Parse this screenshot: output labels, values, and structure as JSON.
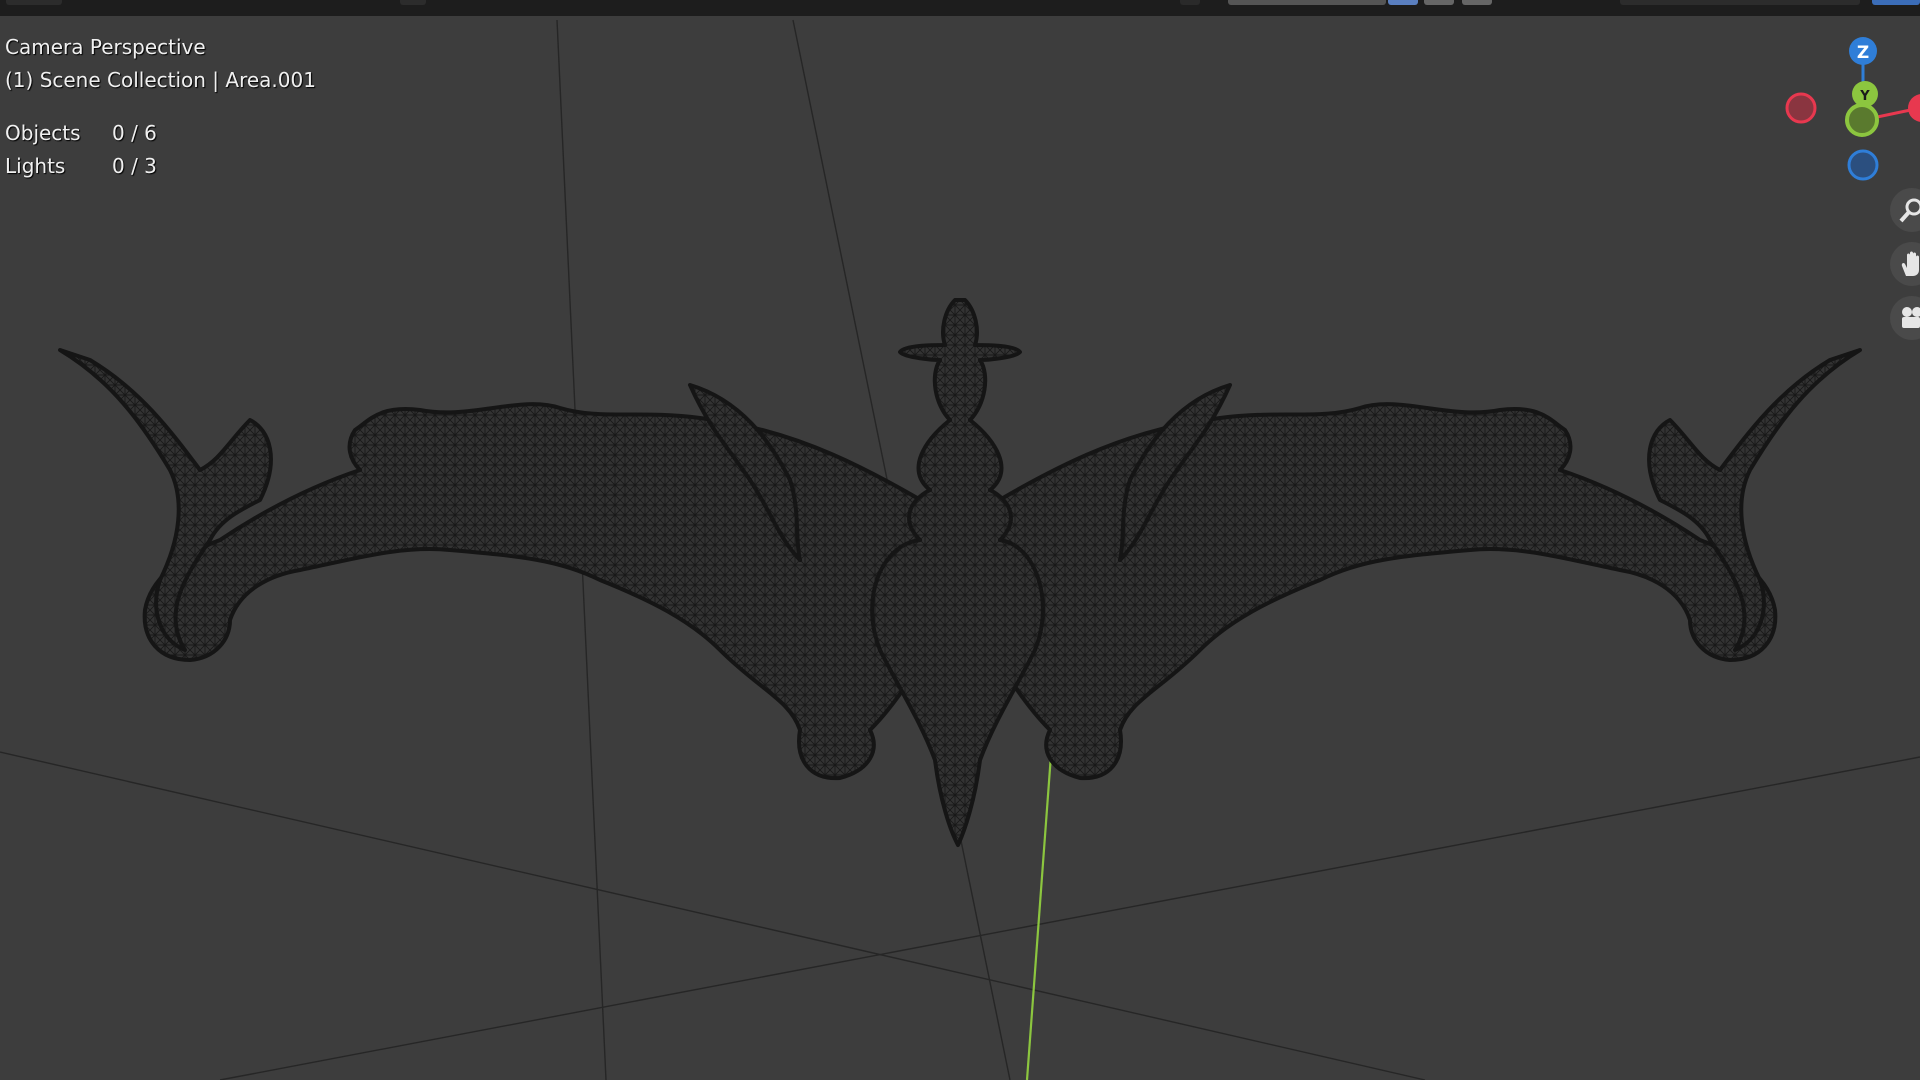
{
  "viewport": {
    "view_name": "Camera Perspective",
    "collection_line": "(1) Scene Collection | Area.001",
    "stats": [
      {
        "label": "Objects",
        "value": "0 / 6"
      },
      {
        "label": "Lights",
        "value": "0 / 3"
      }
    ]
  },
  "gizmo": {
    "z_label": "Z",
    "y_label": "Y",
    "colors": {
      "x": "#e8384f",
      "y": "#8cc63f",
      "z": "#2f7ed8"
    }
  },
  "navigation": {
    "zoom_icon": "magnifier-icon",
    "pan_icon": "hand-icon",
    "camera_icon": "camera-icon"
  },
  "colors": {
    "background": "#3d3d3d",
    "grid_line": "#2a2a2a",
    "y_axis": "#8cc63f",
    "mesh": "#1e1e1e"
  }
}
